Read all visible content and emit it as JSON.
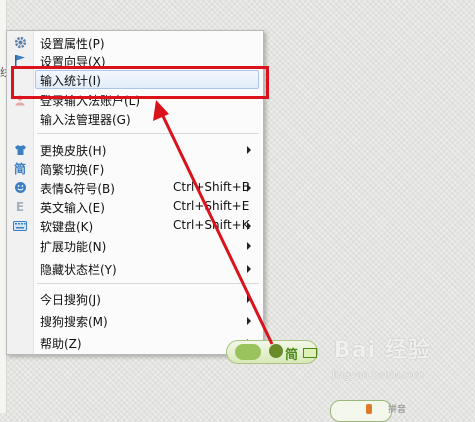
{
  "background_left": {
    "text": "线"
  },
  "menu": {
    "items": [
      {
        "label": "设置属性(P)",
        "icon": "gear-icon"
      },
      {
        "label": "设置向导(X)",
        "icon": "flag-icon"
      },
      {
        "label": "输入统计(I)",
        "icon": "",
        "highlighted": true
      },
      {
        "label": "登录输入法账户(L)",
        "icon": "person-icon"
      },
      {
        "label": "输入法管理器(G)",
        "icon": ""
      },
      {
        "label": "更换皮肤(H)",
        "icon": "tshirt-icon",
        "submenu": true
      },
      {
        "label": "简繁切换(F)",
        "icon": "jian-icon",
        "icon_glyph": "简"
      },
      {
        "label": "表情&符号(B)",
        "accel": "Ctrl+Shift+B",
        "icon": "smiley-icon",
        "submenu": true
      },
      {
        "label": "英文输入(E)",
        "accel": "Ctrl+Shift+E",
        "icon": "e-letter-icon",
        "icon_glyph": "E"
      },
      {
        "label": "软键盘(K)",
        "accel": "Ctrl+Shift+K",
        "icon": "keyboard-icon",
        "submenu": true
      },
      {
        "label": "扩展功能(N)",
        "icon": "",
        "submenu": true
      },
      {
        "label": "隐藏状态栏(Y)",
        "icon": "",
        "submenu": true
      },
      {
        "label": "今日搜狗(J)",
        "icon": "",
        "submenu": true
      },
      {
        "label": "搜狗搜索(M)",
        "icon": "",
        "submenu": true
      },
      {
        "label": "帮助(Z)",
        "icon": "",
        "submenu": true
      }
    ]
  },
  "statusbar": {
    "mode": "简"
  },
  "status2": {
    "label": "拼音"
  },
  "watermark": {
    "brand": "Bai 经验",
    "url": "jingyan.baidu.com"
  },
  "colors": {
    "annotation": "#d9121b",
    "accent": "#3c7fc2",
    "statusbar_green": "#4d8a1a"
  }
}
